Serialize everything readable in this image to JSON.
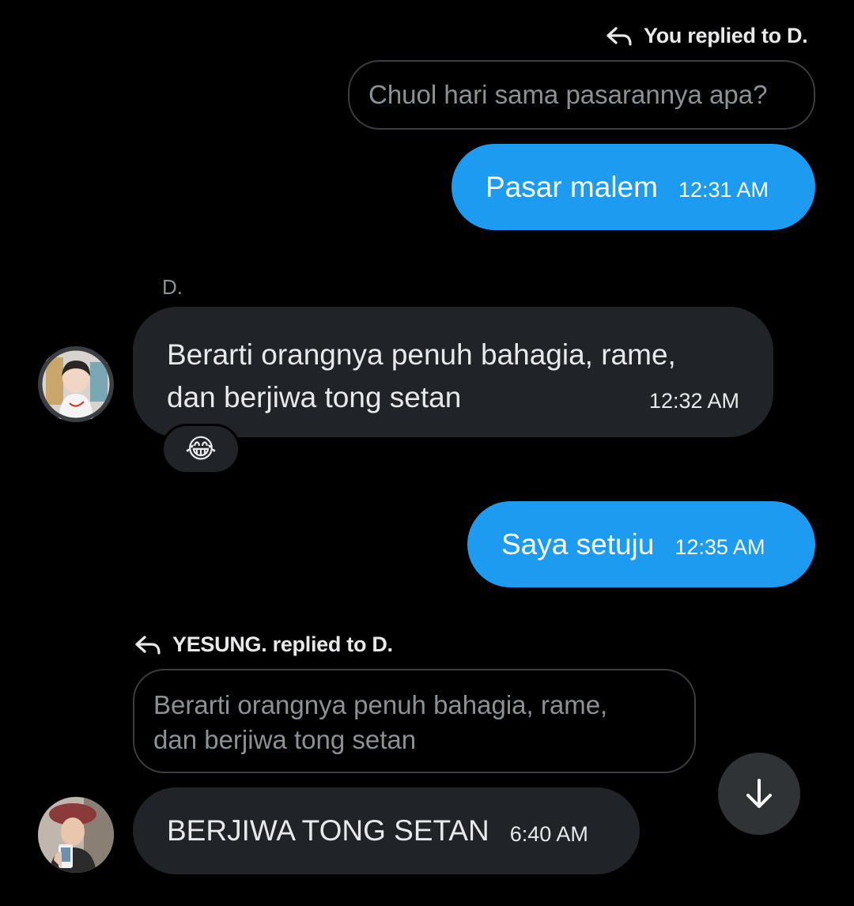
{
  "messages": {
    "m1": {
      "reply_label": "You replied to D.",
      "quoted": "Chuol hari sama pasarannya apa?",
      "text": "Pasar malem",
      "time": "12:31 AM"
    },
    "m2": {
      "sender": "D.",
      "line1": "Berarti orangnya penuh bahagia, rame,",
      "line2": "dan berjiwa tong setan",
      "time": "12:32 AM",
      "reaction": "😂"
    },
    "m3": {
      "text": "Saya setuju",
      "time": "12:35 AM"
    },
    "m4": {
      "reply_label": "YESUNG. replied to D.",
      "quoted_line1": "Berarti orangnya penuh bahagia, rame,",
      "quoted_line2": "dan berjiwa tong setan",
      "text": "BERJIWA TONG SETAN",
      "time": "6:40 AM"
    }
  },
  "icons": {
    "reply": "reply-arrow-icon",
    "scroll_down": "arrow-down-icon"
  },
  "colors": {
    "background": "#000000",
    "outgoing_bubble": "#1d9bf0",
    "incoming_bubble": "#202327",
    "muted_text": "#8b9196"
  }
}
